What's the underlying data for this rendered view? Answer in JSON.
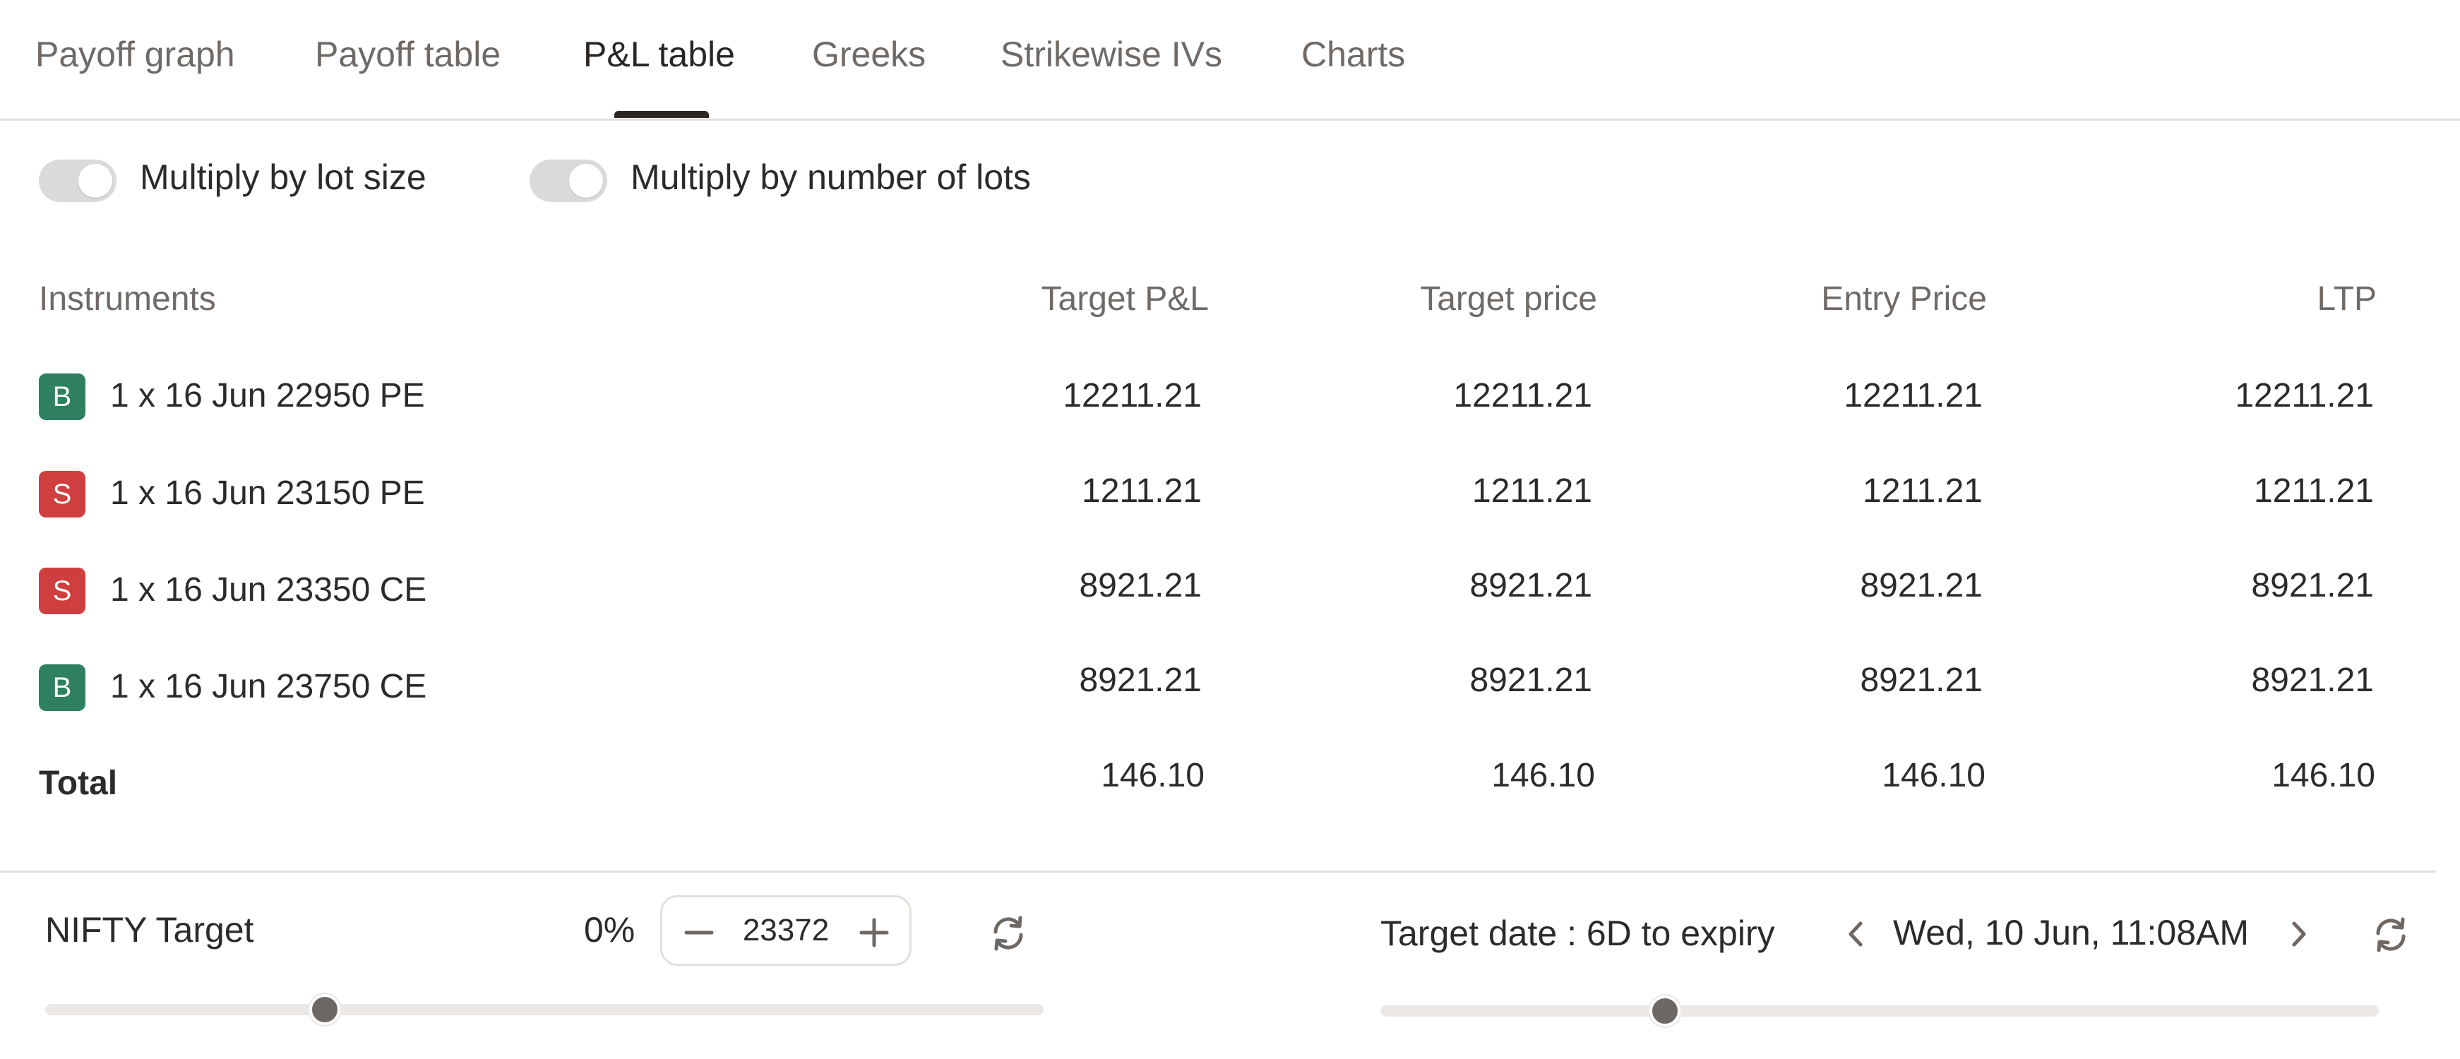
{
  "tabs": [
    {
      "label": "Payoff graph"
    },
    {
      "label": "Payoff table"
    },
    {
      "label": "P&L table",
      "active": true
    },
    {
      "label": "Greeks"
    },
    {
      "label": "Strikewise IVs"
    },
    {
      "label": "Charts"
    }
  ],
  "toggles": {
    "lot_size": {
      "label": "Multiply by lot size"
    },
    "num_lots": {
      "label": "Multiply by number of lots"
    }
  },
  "table": {
    "headers": [
      "Instruments",
      "Target P&L",
      "Target price",
      "Entry Price",
      "LTP"
    ],
    "rows": [
      {
        "side": "B",
        "instrument": "1 x 16 Jun 22950 PE",
        "target_pl": "12211.21",
        "target_price": "12211.21",
        "entry_price": "12211.21",
        "ltp": "12211.21"
      },
      {
        "side": "S",
        "instrument": "1 x 16 Jun 23150 PE",
        "target_pl": "1211.21",
        "target_price": "1211.21",
        "entry_price": "1211.21",
        "ltp": "1211.21"
      },
      {
        "side": "S",
        "instrument": "1 x 16 Jun 23350 CE",
        "target_pl": "8921.21",
        "target_price": "8921.21",
        "entry_price": "8921.21",
        "ltp": "8921.21"
      },
      {
        "side": "B",
        "instrument": "1 x 16 Jun 23750 CE",
        "target_pl": "8921.21",
        "target_price": "8921.21",
        "entry_price": "8921.21",
        "ltp": "8921.21"
      }
    ],
    "total": {
      "label": "Total",
      "target_pl": "146.10",
      "target_price": "146.10",
      "entry_price": "146.10",
      "ltp": "146.10"
    }
  },
  "target": {
    "label": "NIFTY Target",
    "percent": "0%",
    "value": "23372",
    "slider_fraction": 0.28
  },
  "date": {
    "label": "Target date : 6D to expiry",
    "value": "Wed, 10 Jun, 11:08AM",
    "slider_fraction": 0.285
  },
  "colors": {
    "buy": "#2f8060",
    "sell": "#cf3f3f",
    "accent": "#2b2725"
  },
  "icons": {
    "refresh": "refresh-icon",
    "minus": "minus-icon",
    "plus": "plus-icon",
    "chevron_left": "chevron-left-icon",
    "chevron_right": "chevron-right-icon"
  }
}
